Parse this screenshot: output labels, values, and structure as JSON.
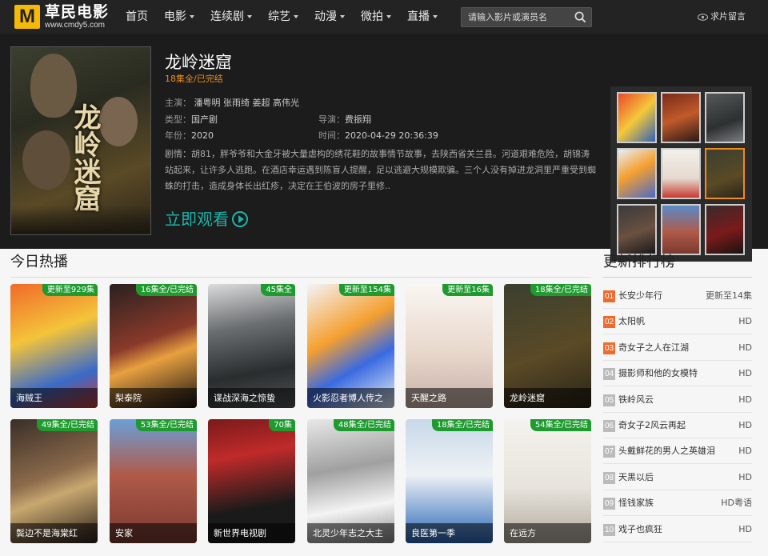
{
  "site": {
    "logo_mark": "M",
    "name": "草民电影",
    "url": "www.cmdy5.com"
  },
  "nav": {
    "items": [
      {
        "label": "首页",
        "has_dropdown": false
      },
      {
        "label": "电影",
        "has_dropdown": true
      },
      {
        "label": "连续剧",
        "has_dropdown": true
      },
      {
        "label": "综艺",
        "has_dropdown": true
      },
      {
        "label": "动漫",
        "has_dropdown": true
      },
      {
        "label": "微拍",
        "has_dropdown": true
      },
      {
        "label": "直播",
        "has_dropdown": true
      }
    ],
    "search_placeholder": "请输入影片或演员名",
    "request_label": "求片留言"
  },
  "featured": {
    "title": "龙岭迷窟",
    "status": "18集全/已完结",
    "cast_label": "主演：",
    "cast": "潘粤明 张雨绮 姜超 高伟光",
    "type_label": "类型：",
    "type": "国产剧",
    "director_label": "导演：",
    "director": "费振翔",
    "year_label": "年份：",
    "year": "2020",
    "time_label": "时间：",
    "time": "2020-04-29 20:36:39",
    "desc_label": "剧情：",
    "description": "胡81，胖爷爷和大金牙被大量虐构的绣花鞋的故事情节故事，去陕西省关兰县。河道艰难危险，胡锦涛站起来，让许多人逃跑。在酒店幸运遇到陈盲人提醒，足以逃避大规模欺骗。三个人没有掉进龙洞里严重受到蜘蛛的打击，造成身体长出红疹，决定在王伯波的房子里修..",
    "watch_label": "立即观看"
  },
  "hot": {
    "title": "今日热播",
    "items": [
      {
        "title": "海贼王",
        "badge": "更新至929集"
      },
      {
        "title": "梨泰院",
        "badge": "16集全/已完结"
      },
      {
        "title": "谍战深海之惊蛰",
        "badge": "45集全"
      },
      {
        "title": "火影忍者博人传之",
        "badge": "更新至154集"
      },
      {
        "title": "天醒之路",
        "badge": "更新至16集"
      },
      {
        "title": "龙岭迷窟",
        "badge": "18集全/已完结"
      },
      {
        "title": "鬓边不是海棠红",
        "badge": "49集全/已完结"
      },
      {
        "title": "安家",
        "badge": "53集全/已完结"
      },
      {
        "title": "新世界电视剧",
        "badge": "70集"
      },
      {
        "title": "北灵少年志之大主",
        "badge": "48集全/已完结"
      },
      {
        "title": "良医第一季",
        "badge": "18集全/已完结"
      },
      {
        "title": "在远方",
        "badge": "54集全/已完结"
      }
    ]
  },
  "ranking": {
    "title": "更新排行榜",
    "items": [
      {
        "num": "01",
        "name": "长安少年行",
        "info": "更新至14集"
      },
      {
        "num": "02",
        "name": "太阳帆",
        "info": "HD"
      },
      {
        "num": "03",
        "name": "奇女子之人在江湖",
        "info": "HD"
      },
      {
        "num": "04",
        "name": "摄影师和他的女模特",
        "info": "HD"
      },
      {
        "num": "05",
        "name": "铁岭风云",
        "info": "HD"
      },
      {
        "num": "06",
        "name": "奇女子2风云再起",
        "info": "HD"
      },
      {
        "num": "07",
        "name": "头戴鲜花的男人之英雄泪",
        "info": "HD"
      },
      {
        "num": "08",
        "name": "天黑以后",
        "info": "HD"
      },
      {
        "num": "09",
        "name": "怪钱家族",
        "info": "HD粤语"
      },
      {
        "num": "10",
        "name": "戏子也疯狂",
        "info": "HD"
      }
    ]
  },
  "colors": {
    "nav_bg": "#232323",
    "hero_bg": "#1c1c1c",
    "accent_orange": "#f08b1d",
    "accent_teal": "#1bb4a8",
    "badge_green": "#1d9b2e"
  }
}
